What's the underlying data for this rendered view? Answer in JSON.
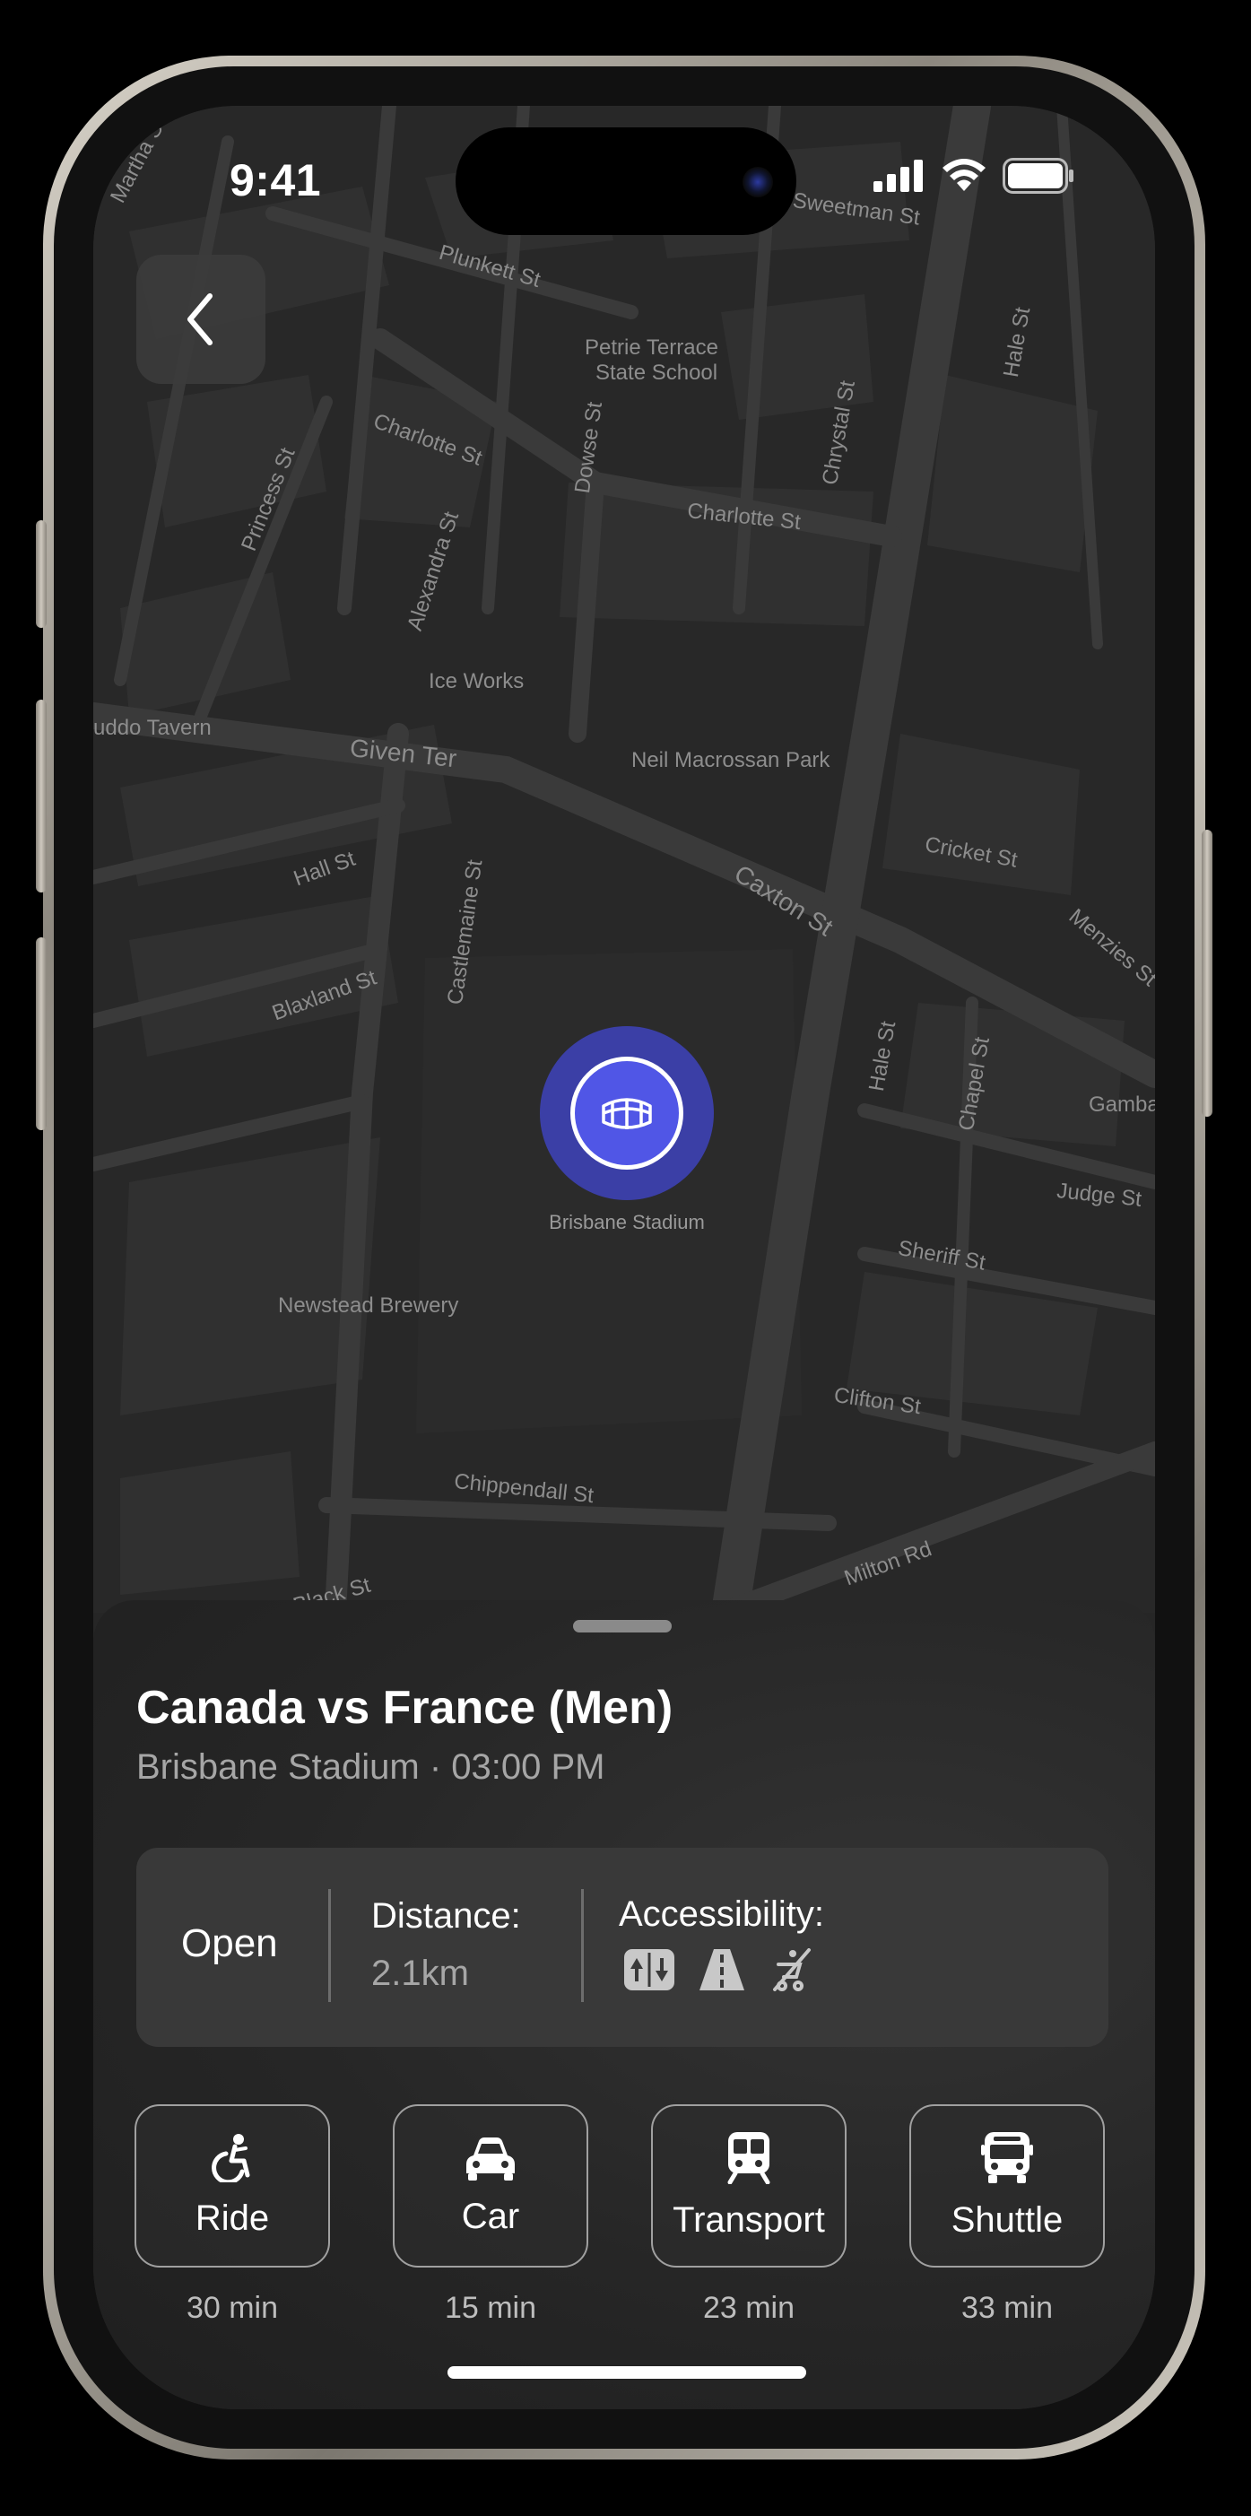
{
  "status_bar": {
    "time": "9:41"
  },
  "map": {
    "streets": [
      {
        "name": "Martha St"
      },
      {
        "name": "Plunkett St"
      },
      {
        "name": "Sweetman St"
      },
      {
        "name": "Petrie Terrace"
      },
      {
        "name": "State School"
      },
      {
        "name": "Charlotte St"
      },
      {
        "name": "Charlotte St"
      },
      {
        "name": "Princess St"
      },
      {
        "name": "Dowse St"
      },
      {
        "name": "Chrystal St"
      },
      {
        "name": "Hale St"
      },
      {
        "name": "Alexandra St"
      },
      {
        "name": "Ice Works"
      },
      {
        "name": "uddo Tavern"
      },
      {
        "name": "Given Ter"
      },
      {
        "name": "Neil Macrossan Park"
      },
      {
        "name": "Hall St"
      },
      {
        "name": "Caxton St"
      },
      {
        "name": "Cricket St"
      },
      {
        "name": "Castlemaine St"
      },
      {
        "name": "Blaxland St"
      },
      {
        "name": "Menzies St"
      },
      {
        "name": "Hale St"
      },
      {
        "name": "Chapel St"
      },
      {
        "name": "Gambar"
      },
      {
        "name": "Judge St"
      },
      {
        "name": "Sheriff St"
      },
      {
        "name": "Newstead Brewery"
      },
      {
        "name": "Clifton St"
      },
      {
        "name": "Chippendall St"
      },
      {
        "name": "Milton Rd"
      },
      {
        "name": "Black St"
      }
    ],
    "marker": {
      "label": "Brisbane Stadium",
      "icon": "stadium-icon",
      "color": "#5056e6"
    }
  },
  "event": {
    "title": "Canada vs France (Men)",
    "subtitle": "Brisbane Stadium · 03:00 PM"
  },
  "info": {
    "status": "Open",
    "distance_label": "Distance:",
    "distance_value": "2.1km",
    "accessibility_label": "Accessibility:",
    "accessibility_icons": [
      "elevator-icon",
      "ramp-icon",
      "no-stroller-icon"
    ]
  },
  "transport_modes": [
    {
      "label": "Ride",
      "time": "30 min",
      "icon": "wheelchair-icon"
    },
    {
      "label": "Car",
      "time": "15 min",
      "icon": "car-icon"
    },
    {
      "label": "Transport",
      "time": "23 min",
      "icon": "train-icon"
    },
    {
      "label": "Shuttle",
      "time": "33 min",
      "icon": "bus-icon"
    }
  ]
}
